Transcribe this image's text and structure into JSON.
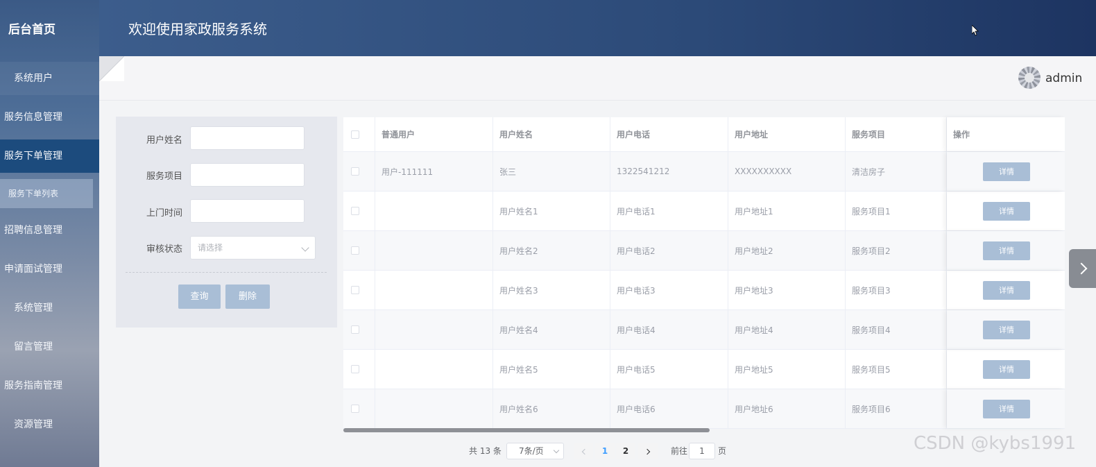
{
  "sidebar": {
    "brand": "后台首页",
    "items": [
      {
        "label": "系统用户"
      },
      {
        "label": "服务信息管理"
      },
      {
        "label": "服务下单管理"
      },
      {
        "label": "服务下单列表"
      },
      {
        "label": "招聘信息管理"
      },
      {
        "label": "申请面试管理"
      },
      {
        "label": "系统管理"
      },
      {
        "label": "留言管理"
      },
      {
        "label": "服务指南管理"
      },
      {
        "label": "资源管理"
      }
    ]
  },
  "header": {
    "title": "欢迎使用家政服务系统"
  },
  "user": {
    "name": "admin"
  },
  "filter": {
    "name_label": "用户姓名",
    "service_label": "服务项目",
    "time_label": "上门时间",
    "status_label": "审核状态",
    "status_placeholder": "请选择",
    "query_label": "查询",
    "delete_label": "删除"
  },
  "table": {
    "headers": [
      "普通用户",
      "用户姓名",
      "用户电话",
      "用户地址",
      "服务项目",
      "操作"
    ],
    "detail_label": "详情",
    "rows": [
      [
        "用户-111111",
        "张三",
        "1322541212",
        "XXXXXXXXXX",
        "清洁房子"
      ],
      [
        "",
        "用户姓名1",
        "用户电话1",
        "用户地址1",
        "服务项目1"
      ],
      [
        "",
        "用户姓名2",
        "用户电话2",
        "用户地址2",
        "服务项目2"
      ],
      [
        "",
        "用户姓名3",
        "用户电话3",
        "用户地址3",
        "服务项目3"
      ],
      [
        "",
        "用户姓名4",
        "用户电话4",
        "用户地址4",
        "服务项目4"
      ],
      [
        "",
        "用户姓名5",
        "用户电话5",
        "用户地址5",
        "服务项目5"
      ],
      [
        "",
        "用户姓名6",
        "用户电话6",
        "用户地址6",
        "服务项目6"
      ]
    ]
  },
  "pagination": {
    "total": "共 13 条",
    "page_size": "7条/页",
    "pages": [
      "1",
      "2"
    ],
    "goto_label": "前往",
    "goto_value": "1",
    "page_suffix": "页"
  },
  "watermark": "CSDN @kybs1991"
}
